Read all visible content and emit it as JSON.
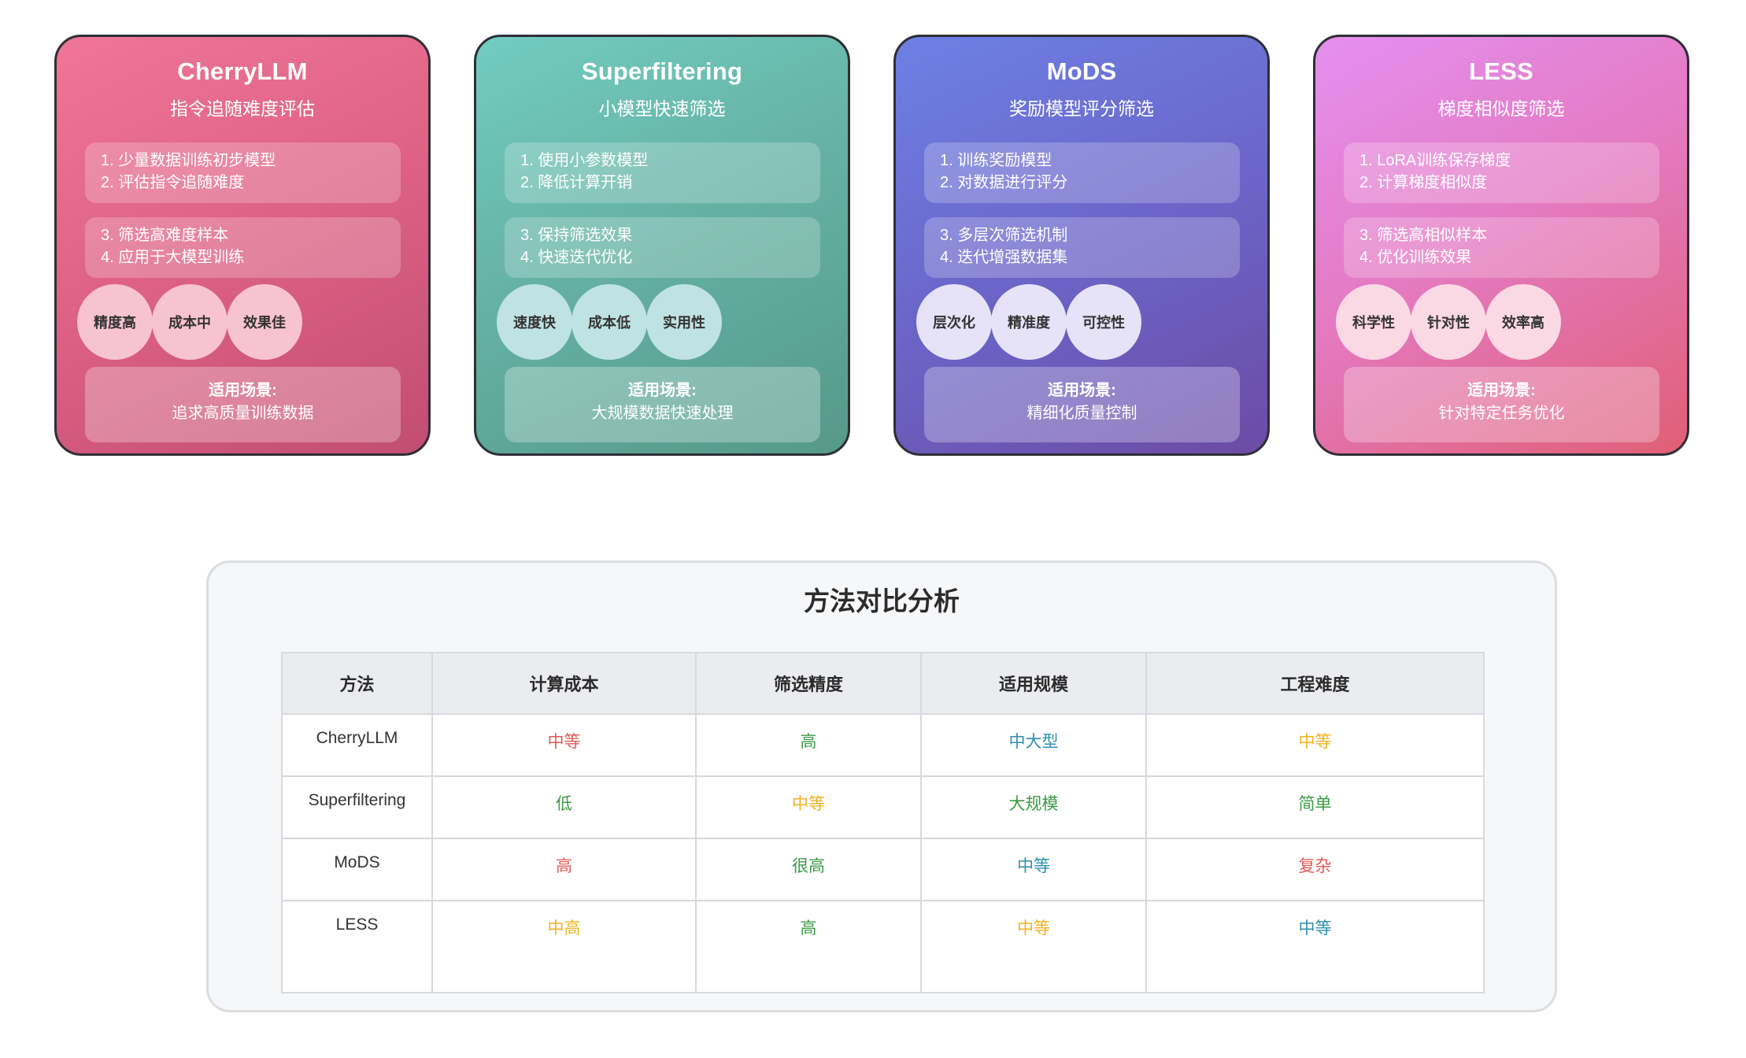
{
  "methods": [
    {
      "title": "CherryLLM",
      "subtitle": "指令追随难度评估",
      "steps": [
        "1. 少量数据训练初步模型",
        "2. 评估指令追随难度",
        "3. 筛选高难度样本",
        "4. 应用于大模型训练"
      ],
      "tags": [
        "精度高",
        "成本中",
        "效果佳"
      ],
      "scene_label": "适用场景:",
      "scene_value": "追求高质量训练数据"
    },
    {
      "title": "Superfiltering",
      "subtitle": "小模型快速筛选",
      "steps": [
        "1. 使用小参数模型",
        "2. 降低计算开销",
        "3. 保持筛选效果",
        "4. 快速迭代优化"
      ],
      "tags": [
        "速度快",
        "成本低",
        "实用性"
      ],
      "scene_label": "适用场景:",
      "scene_value": "大规模数据快速处理"
    },
    {
      "title": "MoDS",
      "subtitle": "奖励模型评分筛选",
      "steps": [
        "1. 训练奖励模型",
        "2. 对数据进行评分",
        "3. 多层次筛选机制",
        "4. 迭代增强数据集"
      ],
      "tags": [
        "层次化",
        "精准度",
        "可控性"
      ],
      "scene_label": "适用场景:",
      "scene_value": "精细化质量控制"
    },
    {
      "title": "LESS",
      "subtitle": "梯度相似度筛选",
      "steps": [
        "1. LoRA训练保存梯度",
        "2. 计算梯度相似度",
        "3. 筛选高相似样本",
        "4. 优化训练效果"
      ],
      "tags": [
        "科学性",
        "针对性",
        "效率高"
      ],
      "scene_label": "适用场景:",
      "scene_value": "针对特定任务优化"
    }
  ],
  "comparison": {
    "title": "方法对比分析",
    "headers": [
      "方法",
      "计算成本",
      "筛选精度",
      "适用规模",
      "工程难度"
    ],
    "rows": [
      [
        "CherryLLM",
        "中等",
        "高",
        "中大型",
        "中等"
      ],
      [
        "Superfiltering",
        "低",
        "中等",
        "大规模",
        "简单"
      ],
      [
        "MoDS",
        "高",
        "很高",
        "中等",
        "复杂"
      ],
      [
        "LESS",
        "中高",
        "高",
        "中等",
        "中等"
      ]
    ]
  },
  "colors": {
    "red": "#e05a57",
    "green": "#3c9a46",
    "blue": "#2d8fb0",
    "orange": "#efb322"
  }
}
